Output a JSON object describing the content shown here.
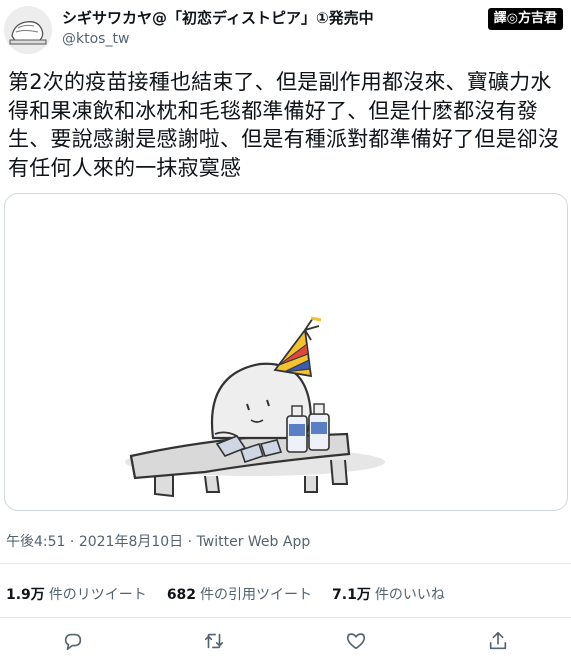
{
  "author": {
    "display_name": "シギサワカヤ@「初恋ディストピア」①発売中",
    "handle": "@ktos_tw"
  },
  "translator_badge": "譯◎方吉君",
  "tweet": {
    "text": "第2次的疫苗接種也結束了、但是副作用都沒來、寶礦力水得和果凍飲和冰枕和毛毯都準備好了、但是什麽都沒有發生、要說感謝是感謝啦、但是有種派對都準備好了但是卻沒有任何人來的一抹寂寞感"
  },
  "meta": {
    "time": "午後4:51",
    "date": "2021年8月10日",
    "client": "Twitter Web App"
  },
  "stats": {
    "retweets": {
      "count": "1.9万",
      "label": "件のリツイート"
    },
    "quotes": {
      "count": "682",
      "label": "件の引用ツイート"
    },
    "likes": {
      "count": "7.1万",
      "label": "件のいいね"
    }
  },
  "actions": [
    {
      "icon": "reply-icon"
    },
    {
      "icon": "retweet-icon"
    },
    {
      "icon": "like-icon"
    },
    {
      "icon": "share-icon"
    }
  ],
  "colors": {
    "text": "#0f1419",
    "secondary": "#536471",
    "border": "#cfd9de",
    "hat_red": "#d94a3a",
    "hat_blue": "#3a5db0",
    "hat_yellow": "#f2c230",
    "bottle_blue": "#5b7fc4"
  }
}
